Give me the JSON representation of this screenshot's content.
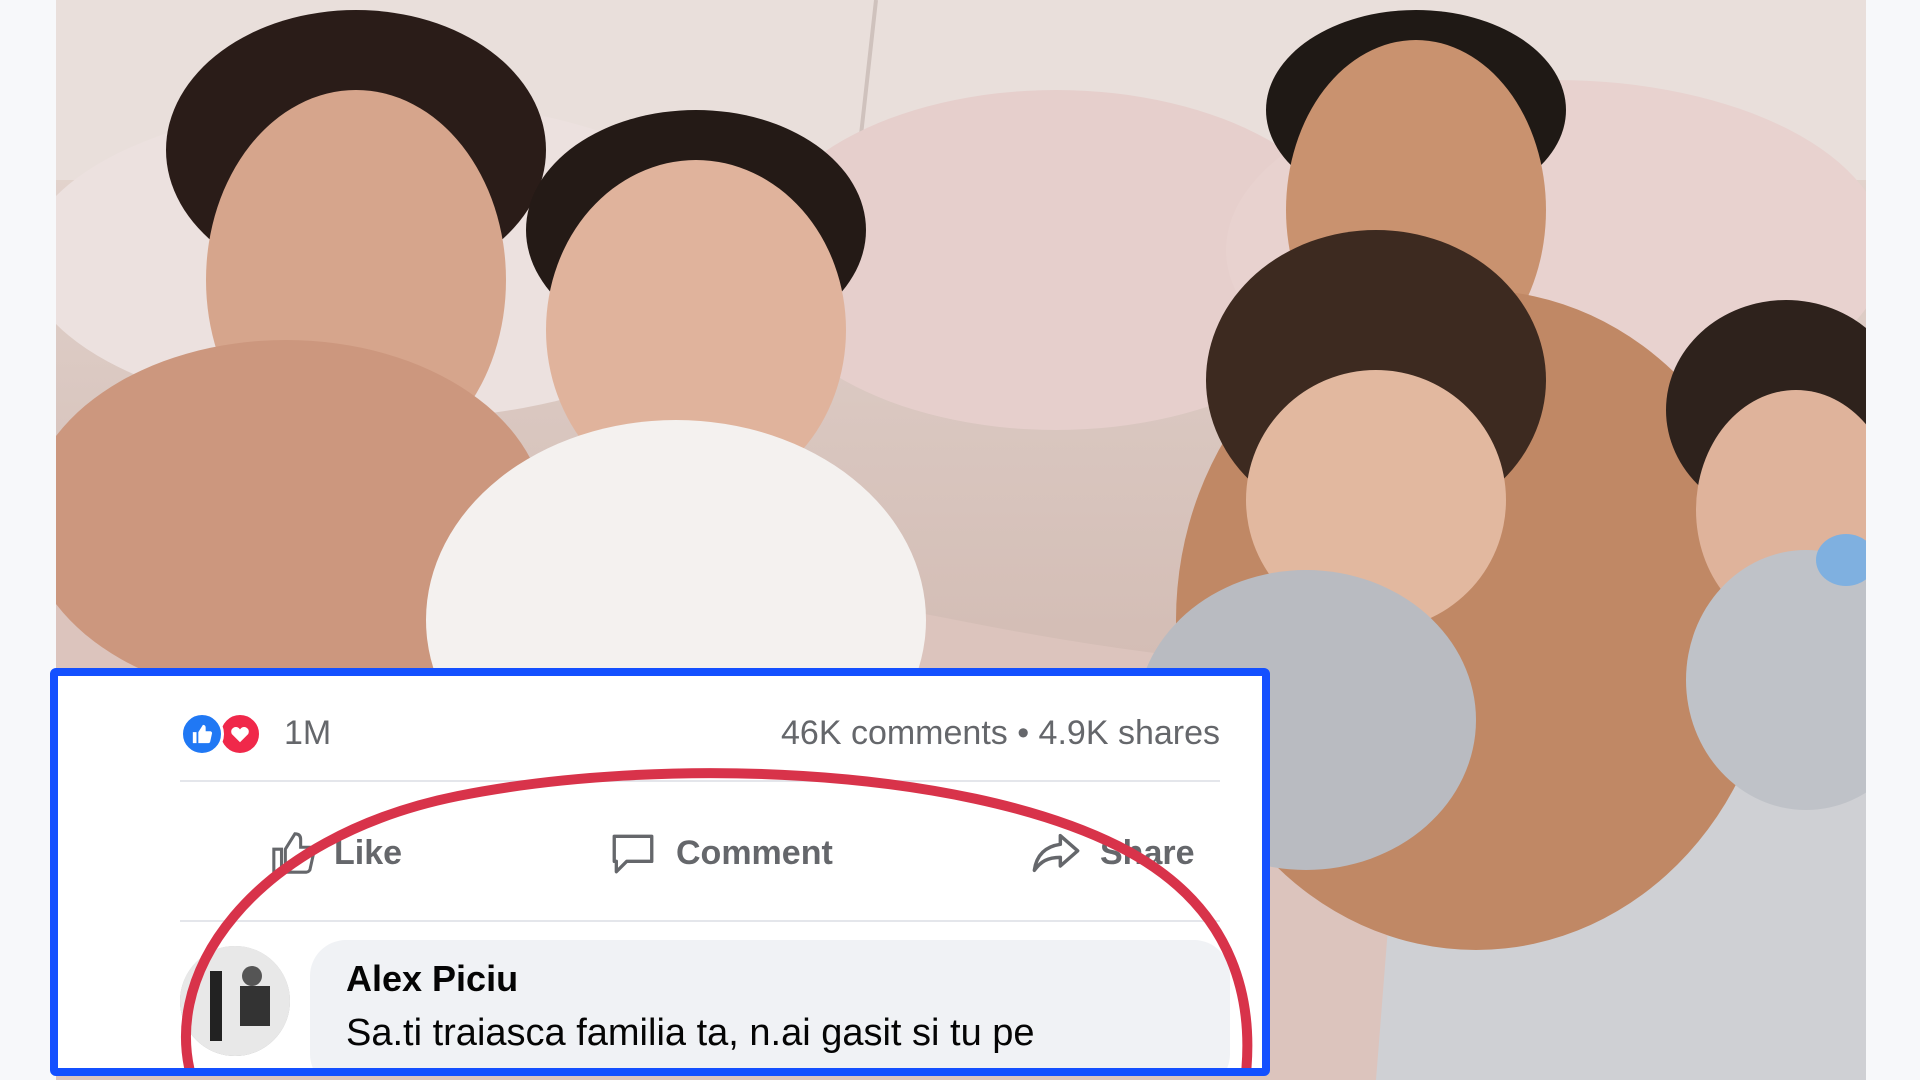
{
  "post": {
    "reaction_count": "1M",
    "stats": "46K comments • 4.9K shares",
    "actions": {
      "like_label": "Like",
      "comment_label": "Comment",
      "share_label": "Share"
    },
    "reaction_icons": [
      "like-icon",
      "love-icon"
    ]
  },
  "comment": {
    "author": "Alex Piciu",
    "text": "Sa.ti traiasca familia ta, n.ai gasit si tu pe"
  },
  "colors": {
    "highlight_border": "#1450ff",
    "annotation_circle": "#d8334a",
    "like_blue": "#2078f4",
    "love_red": "#f0284a",
    "muted_text": "#65676b"
  }
}
